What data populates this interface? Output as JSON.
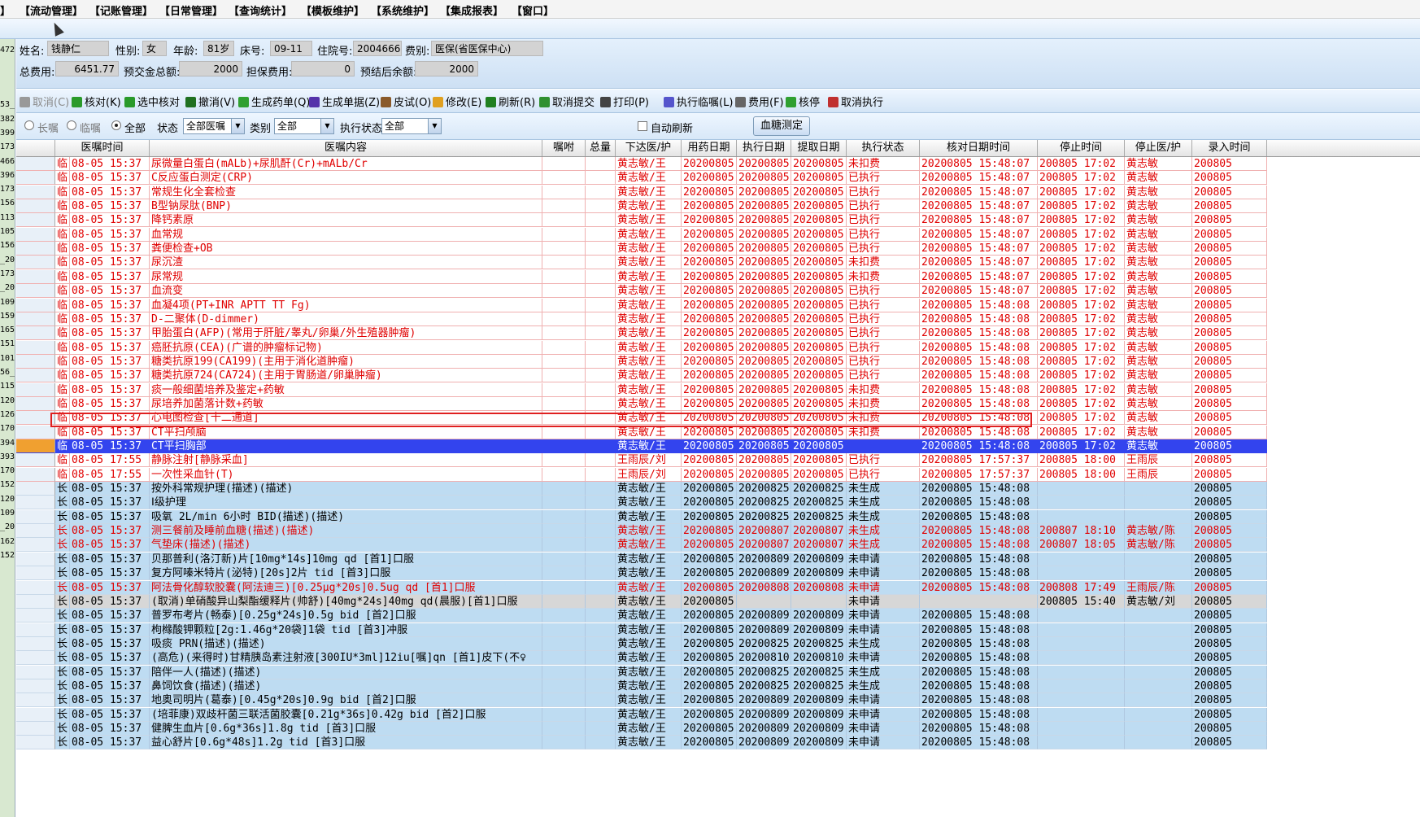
{
  "menu": [
    "】",
    "【流动管理】",
    "【记账管理】",
    "【日常管理】",
    "【查询统计】",
    "【模板维护】",
    "【系统维护】",
    "【集成报表】",
    "【窗口】"
  ],
  "patient": {
    "name_label": "姓名:",
    "name": "钱静仁",
    "sex_label": "性别:",
    "sex": "女",
    "age_label": "年龄:",
    "age": "81岁",
    "bed_label": "床号:",
    "bed": "09-11",
    "inpatient_label": "住院号:",
    "inpatient_no": "2004666",
    "type_label": "费别:",
    "type": "医保(省医保中心)",
    "total_label": "总费用:",
    "total": "6451.77",
    "prepay_label": "预交金总额:",
    "prepay": "2000",
    "guarantee_label": "担保费用:",
    "guarantee": "0",
    "balance_label": "预结后余额:",
    "balance": "2000"
  },
  "toolbar": [
    {
      "label": "取消(C)",
      "icon": "undo-icon",
      "disabled": true
    },
    {
      "label": "核对(K)",
      "icon": "check-icon"
    },
    {
      "label": "选中核对",
      "icon": "check-selected-icon"
    },
    {
      "label": "撤消(V)",
      "icon": "revoke-icon"
    },
    {
      "label": "生成药单(Q)",
      "icon": "medicine-icon"
    },
    {
      "label": "生成单据(Z)",
      "icon": "document-icon"
    },
    {
      "label": "皮试(O)",
      "icon": "needle-icon"
    },
    {
      "label": "修改(E)",
      "icon": "edit-icon"
    },
    {
      "label": "刷新(R)",
      "icon": "refresh-icon"
    },
    {
      "label": "取消提交",
      "icon": "cancel-submit-icon"
    },
    {
      "label": "打印(P)",
      "icon": "printer-icon"
    },
    {
      "label": "执行临嘱(L)",
      "icon": "gear-icon"
    },
    {
      "label": "费用(F)",
      "icon": "fee-icon"
    },
    {
      "label": "核停",
      "icon": "check-stop-icon"
    },
    {
      "label": "取消执行",
      "icon": "cancel-exec-icon"
    }
  ],
  "filters": {
    "radio_long": "长嘱",
    "radio_temp": "临嘱",
    "radio_all": "全部",
    "status_label": "状态",
    "status_value": "全部医嘱",
    "category_label": "类别",
    "category_value": "全部",
    "exec_label": "执行状态",
    "exec_value": "全部",
    "auto_refresh": "自动刷新",
    "glucose_button": "血糖测定",
    "dropdown_arrow": "▼"
  },
  "columns": [
    "",
    "医嘱时间",
    "医嘱内容",
    "嘱咐",
    "总量",
    "下达医/护",
    "用药日期",
    "执行日期",
    "提取日期",
    "执行状态",
    "核对日期时间",
    "停止时间",
    "停止医/护",
    "录入时间"
  ],
  "left_strip": [
    "472",
    "53_",
    "382",
    "399",
    "173",
    "466",
    "396",
    "173",
    "156",
    "113",
    "105",
    "156",
    "_20",
    "173",
    "_20",
    "109",
    "159",
    "165",
    "151",
    "101",
    "56_",
    "115",
    "120",
    "126",
    "170",
    "394",
    "393",
    "170",
    "152",
    "120",
    "109",
    "_20",
    "162",
    "152"
  ],
  "rows": [
    {
      "s": "temp",
      "c": [
        "临",
        "08-05 15:37",
        "尿微量白蛋白(mALb)+尿肌酐(Cr)+mALb/Cr",
        "",
        "",
        "黄志敏/王",
        "20200805",
        "20200805",
        "20200805",
        "未扣费",
        "20200805 15:48:07",
        "200805 17:02",
        "黄志敏",
        "200805"
      ]
    },
    {
      "s": "temp",
      "c": [
        "临",
        "08-05 15:37",
        "C反应蛋白测定(CRP)",
        "",
        "",
        "黄志敏/王",
        "20200805",
        "20200805",
        "20200805",
        "已执行",
        "20200805 15:48:07",
        "200805 17:02",
        "黄志敏",
        "200805"
      ]
    },
    {
      "s": "temp",
      "c": [
        "临",
        "08-05 15:37",
        "常规生化全套检查",
        "",
        "",
        "黄志敏/王",
        "20200805",
        "20200805",
        "20200805",
        "已执行",
        "20200805 15:48:07",
        "200805 17:02",
        "黄志敏",
        "200805"
      ]
    },
    {
      "s": "temp",
      "c": [
        "临",
        "08-05 15:37",
        "B型钠尿肽(BNP)",
        "",
        "",
        "黄志敏/王",
        "20200805",
        "20200805",
        "20200805",
        "已执行",
        "20200805 15:48:07",
        "200805 17:02",
        "黄志敏",
        "200805"
      ]
    },
    {
      "s": "temp",
      "c": [
        "临",
        "08-05 15:37",
        "降钙素原",
        "",
        "",
        "黄志敏/王",
        "20200805",
        "20200805",
        "20200805",
        "已执行",
        "20200805 15:48:07",
        "200805 17:02",
        "黄志敏",
        "200805"
      ]
    },
    {
      "s": "temp",
      "c": [
        "临",
        "08-05 15:37",
        "血常规",
        "",
        "",
        "黄志敏/王",
        "20200805",
        "20200805",
        "20200805",
        "已执行",
        "20200805 15:48:07",
        "200805 17:02",
        "黄志敏",
        "200805"
      ]
    },
    {
      "s": "temp",
      "c": [
        "临",
        "08-05 15:37",
        "粪便检查+OB",
        "",
        "",
        "黄志敏/王",
        "20200805",
        "20200805",
        "20200805",
        "已执行",
        "20200805 15:48:07",
        "200805 17:02",
        "黄志敏",
        "200805"
      ]
    },
    {
      "s": "temp",
      "c": [
        "临",
        "08-05 15:37",
        "尿沉渣",
        "",
        "",
        "黄志敏/王",
        "20200805",
        "20200805",
        "20200805",
        "未扣费",
        "20200805 15:48:07",
        "200805 17:02",
        "黄志敏",
        "200805"
      ]
    },
    {
      "s": "temp",
      "c": [
        "临",
        "08-05 15:37",
        "尿常规",
        "",
        "",
        "黄志敏/王",
        "20200805",
        "20200805",
        "20200805",
        "未扣费",
        "20200805 15:48:07",
        "200805 17:02",
        "黄志敏",
        "200805"
      ]
    },
    {
      "s": "temp",
      "c": [
        "临",
        "08-05 15:37",
        "血流变",
        "",
        "",
        "黄志敏/王",
        "20200805",
        "20200805",
        "20200805",
        "已执行",
        "20200805 15:48:07",
        "200805 17:02",
        "黄志敏",
        "200805"
      ]
    },
    {
      "s": "temp",
      "c": [
        "临",
        "08-05 15:37",
        "血凝4项(PT+INR APTT TT Fg)",
        "",
        "",
        "黄志敏/王",
        "20200805",
        "20200805",
        "20200805",
        "已执行",
        "20200805 15:48:08",
        "200805 17:02",
        "黄志敏",
        "200805"
      ]
    },
    {
      "s": "temp",
      "c": [
        "临",
        "08-05 15:37",
        "D-二聚体(D-dimmer)",
        "",
        "",
        "黄志敏/王",
        "20200805",
        "20200805",
        "20200805",
        "已执行",
        "20200805 15:48:08",
        "200805 17:02",
        "黄志敏",
        "200805"
      ]
    },
    {
      "s": "temp",
      "c": [
        "临",
        "08-05 15:37",
        "甲胎蛋白(AFP)(常用于肝脏/睾丸/卵巢/外生殖器肿瘤)",
        "",
        "",
        "黄志敏/王",
        "20200805",
        "20200805",
        "20200805",
        "已执行",
        "20200805 15:48:08",
        "200805 17:02",
        "黄志敏",
        "200805"
      ]
    },
    {
      "s": "temp",
      "c": [
        "临",
        "08-05 15:37",
        "癌胚抗原(CEA)(广谱的肿瘤标记物)",
        "",
        "",
        "黄志敏/王",
        "20200805",
        "20200805",
        "20200805",
        "已执行",
        "20200805 15:48:08",
        "200805 17:02",
        "黄志敏",
        "200805"
      ]
    },
    {
      "s": "temp",
      "c": [
        "临",
        "08-05 15:37",
        "糖类抗原199(CA199)(主用于消化道肿瘤)",
        "",
        "",
        "黄志敏/王",
        "20200805",
        "20200805",
        "20200805",
        "已执行",
        "20200805 15:48:08",
        "200805 17:02",
        "黄志敏",
        "200805"
      ]
    },
    {
      "s": "temp",
      "c": [
        "临",
        "08-05 15:37",
        "糖类抗原724(CA724)(主用于胃肠道/卵巢肿瘤)",
        "",
        "",
        "黄志敏/王",
        "20200805",
        "20200805",
        "20200805",
        "已执行",
        "20200805 15:48:08",
        "200805 17:02",
        "黄志敏",
        "200805"
      ]
    },
    {
      "s": "temp",
      "c": [
        "临",
        "08-05 15:37",
        "痰一般细菌培养及鉴定+药敏",
        "",
        "",
        "黄志敏/王",
        "20200805",
        "20200805",
        "20200805",
        "未扣费",
        "20200805 15:48:08",
        "200805 17:02",
        "黄志敏",
        "200805"
      ]
    },
    {
      "s": "temp",
      "c": [
        "临",
        "08-05 15:37",
        "尿培养加菌落计数+药敏",
        "",
        "",
        "黄志敏/王",
        "20200805",
        "20200805",
        "20200805",
        "未扣费",
        "20200805 15:48:08",
        "200805 17:02",
        "黄志敏",
        "200805"
      ]
    },
    {
      "s": "temp",
      "c": [
        "临",
        "08-05 15:37",
        "心电图检查[十二通道]",
        "",
        "",
        "黄志敏/王",
        "20200805",
        "20200805",
        "20200805",
        "未扣费",
        "20200805 15:48:08",
        "200805 17:02",
        "黄志敏",
        "200805"
      ]
    },
    {
      "s": "temp",
      "c": [
        "临",
        "08-05 15:37",
        "CT平扫颅脑",
        "",
        "",
        "黄志敏/王",
        "20200805",
        "20200805",
        "20200805",
        "未扣费",
        "20200805 15:48:08",
        "200805 17:02",
        "黄志敏",
        "200805"
      ]
    },
    {
      "s": "selected",
      "c": [
        "临",
        "08-05 15:37",
        "CT平扫胸部",
        "",
        "",
        "黄志敏/王",
        "20200805",
        "20200805",
        "20200805",
        "",
        "20200805 15:48:08",
        "200805 17:02",
        "黄志敏",
        "200805"
      ]
    },
    {
      "s": "temp",
      "c": [
        "临",
        "08-05 17:55",
        "静脉注射[静脉采血]",
        "",
        "",
        "王雨辰/刘",
        "20200805",
        "20200805",
        "20200805",
        "已执行",
        "20200805 17:57:37",
        "200805 18:00",
        "王雨辰",
        "200805"
      ]
    },
    {
      "s": "temp",
      "c": [
        "临",
        "08-05 17:55",
        "一次性采血针(T)",
        "",
        "",
        "王雨辰/刘",
        "20200805",
        "20200805",
        "20200805",
        "已执行",
        "20200805 17:57:37",
        "200805 18:00",
        "王雨辰",
        "200805"
      ]
    },
    {
      "s": "long",
      "c": [
        "长",
        "08-05 15:37",
        "按外科常规护理(描述)(描述)",
        "",
        "",
        "黄志敏/王",
        "20200805",
        "20200825",
        "20200825",
        "未生成",
        "20200805 15:48:08",
        "",
        "",
        "200805"
      ]
    },
    {
      "s": "long",
      "c": [
        "长",
        "08-05 15:37",
        "Ⅰ级护理",
        "",
        "",
        "黄志敏/王",
        "20200805",
        "20200825",
        "20200825",
        "未生成",
        "20200805 15:48:08",
        "",
        "",
        "200805"
      ]
    },
    {
      "s": "long",
      "c": [
        "长",
        "08-05 15:37",
        "吸氧 2L/min 6小时 BID(描述)(描述)",
        "",
        "",
        "黄志敏/王",
        "20200805",
        "20200825",
        "20200825",
        "未生成",
        "20200805 15:48:08",
        "",
        "",
        "200805"
      ]
    },
    {
      "s": "longred",
      "c": [
        "长",
        "08-05 15:37",
        "测三餐前及睡前血糖(描述)(描述)",
        "",
        "",
        "黄志敏/王",
        "20200805",
        "20200807",
        "20200807",
        "未生成",
        "20200805 15:48:08",
        "200807 18:10",
        "黄志敏/陈",
        "200805"
      ]
    },
    {
      "s": "longred",
      "c": [
        "长",
        "08-05 15:37",
        "气垫床(描述)(描述)",
        "",
        "",
        "黄志敏/王",
        "20200805",
        "20200807",
        "20200807",
        "未生成",
        "20200805 15:48:08",
        "200807 18:05",
        "黄志敏/陈",
        "200805"
      ]
    },
    {
      "s": "long",
      "c": [
        "长",
        "08-05 15:37",
        "贝那普利(洛汀新)片[10mg*14s]10mg qd [首1]口服",
        "",
        "",
        "黄志敏/王",
        "20200805",
        "20200809",
        "20200809",
        "未申请",
        "20200805 15:48:08",
        "",
        "",
        "200805"
      ]
    },
    {
      "s": "long",
      "c": [
        "长",
        "08-05 15:37",
        "复方阿嗪米特片(泌特)[20s]2片 tid [首3]口服",
        "",
        "",
        "黄志敏/王",
        "20200805",
        "20200809",
        "20200809",
        "未申请",
        "20200805 15:48:08",
        "",
        "",
        "200805"
      ]
    },
    {
      "s": "longred",
      "c": [
        "长",
        "08-05 15:37",
        "阿法骨化醇软胶囊(阿法迪三)[0.25μg*20s]0.5ug qd [首1]口服",
        "",
        "",
        "黄志敏/王",
        "20200805",
        "20200808",
        "20200808",
        "未申请",
        "20200805 15:48:08",
        "200808 17:49",
        "王雨辰/陈",
        "200805"
      ]
    },
    {
      "s": "cancel",
      "c": [
        "长",
        "08-05 15:37",
        "(取消)单硝酸异山梨酯缓释片(帅舒)[40mg*24s]40mg qd(晨服)[首1]口服",
        "",
        "",
        "黄志敏/王",
        "20200805",
        "",
        "",
        "未申请",
        "",
        "200805 15:40",
        "黄志敏/刘",
        "200805"
      ]
    },
    {
      "s": "long",
      "c": [
        "长",
        "08-05 15:37",
        "普罗布考片(畅泰)[0.25g*24s]0.5g bid [首2]口服",
        "",
        "",
        "黄志敏/王",
        "20200805",
        "20200809",
        "20200809",
        "未申请",
        "20200805 15:48:08",
        "",
        "",
        "200805"
      ]
    },
    {
      "s": "long",
      "c": [
        "长",
        "08-05 15:37",
        "枸橼酸钾颗粒[2g:1.46g*20袋]1袋 tid [首3]冲服",
        "",
        "",
        "黄志敏/王",
        "20200805",
        "20200809",
        "20200809",
        "未申请",
        "20200805 15:48:08",
        "",
        "",
        "200805"
      ]
    },
    {
      "s": "long",
      "c": [
        "长",
        "08-05 15:37",
        "吸痰 PRN(描述)(描述)",
        "",
        "",
        "黄志敏/王",
        "20200805",
        "20200825",
        "20200825",
        "未生成",
        "20200805 15:48:08",
        "",
        "",
        "200805"
      ]
    },
    {
      "s": "long",
      "c": [
        "长",
        "08-05 15:37",
        "(高危)(来得时)甘精胰岛素注射液[300IU*3ml]12iu[嘱]qn [首1]皮下(不♀",
        "",
        "",
        "黄志敏/王",
        "20200805",
        "20200810",
        "20200810",
        "未申请",
        "20200805 15:48:08",
        "",
        "",
        "200805"
      ]
    },
    {
      "s": "long",
      "c": [
        "长",
        "08-05 15:37",
        "陪伴一人(描述)(描述)",
        "",
        "",
        "黄志敏/王",
        "20200805",
        "20200825",
        "20200825",
        "未生成",
        "20200805 15:48:08",
        "",
        "",
        "200805"
      ]
    },
    {
      "s": "long",
      "c": [
        "长",
        "08-05 15:37",
        "鼻饲饮食(描述)(描述)",
        "",
        "",
        "黄志敏/王",
        "20200805",
        "20200825",
        "20200825",
        "未生成",
        "20200805 15:48:08",
        "",
        "",
        "200805"
      ]
    },
    {
      "s": "long",
      "c": [
        "长",
        "08-05 15:37",
        "地奥司明片(葛泰)[0.45g*20s]0.9g bid [首2]口服",
        "",
        "",
        "黄志敏/王",
        "20200805",
        "20200809",
        "20200809",
        "未申请",
        "20200805 15:48:08",
        "",
        "",
        "200805"
      ]
    },
    {
      "s": "long",
      "c": [
        "长",
        "08-05 15:37",
        "(培菲康)双歧杆菌三联活菌胶囊[0.21g*36s]0.42g bid [首2]口服",
        "",
        "",
        "黄志敏/王",
        "20200805",
        "20200809",
        "20200809",
        "未申请",
        "20200805 15:48:08",
        "",
        "",
        "200805"
      ]
    },
    {
      "s": "long",
      "c": [
        "长",
        "08-05 15:37",
        "健脾生血片[0.6g*36s]1.8g tid [首3]口服",
        "",
        "",
        "黄志敏/王",
        "20200805",
        "20200809",
        "20200809",
        "未申请",
        "20200805 15:48:08",
        "",
        "",
        "200805"
      ]
    },
    {
      "s": "long",
      "c": [
        "长",
        "08-05 15:37",
        "益心舒片[0.6g*48s]1.2g tid [首3]口服",
        "",
        "",
        "黄志敏/王",
        "20200805",
        "20200809",
        "20200809",
        "未申请",
        "20200805 15:48:08",
        "",
        "",
        "200805"
      ]
    }
  ]
}
